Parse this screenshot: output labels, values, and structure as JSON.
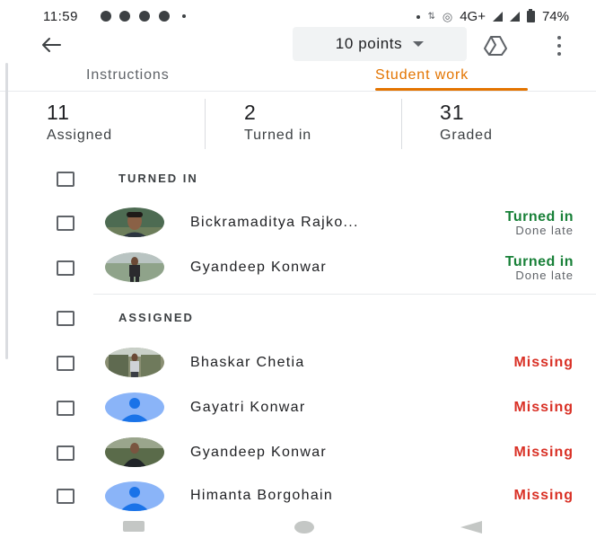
{
  "status_bar": {
    "time": "11:59",
    "network": "4G+",
    "battery": "74%"
  },
  "app_bar": {
    "points_label": "10 points"
  },
  "tabs": [
    {
      "label": "Instructions",
      "active": false
    },
    {
      "label": "Student work",
      "active": true
    }
  ],
  "stats": [
    {
      "count": "11",
      "label": "Assigned"
    },
    {
      "count": "2",
      "label": "Turned in"
    },
    {
      "count": "31",
      "label": "Graded"
    }
  ],
  "sections": {
    "turned_in": {
      "label": "TURNED IN",
      "students": [
        {
          "name": "Bickramaditya Rajko...",
          "status": "Turned in",
          "sub_status": "Done late"
        },
        {
          "name": "Gyandeep Konwar",
          "status": "Turned in",
          "sub_status": "Done late"
        }
      ]
    },
    "assigned": {
      "label": "ASSIGNED",
      "students": [
        {
          "name": "Bhaskar Chetia",
          "status": "Missing"
        },
        {
          "name": "Gayatri Konwar",
          "status": "Missing"
        },
        {
          "name": "Gyandeep Konwar",
          "status": "Missing"
        },
        {
          "name": "Himanta Borgohain",
          "status": "Missing"
        }
      ]
    }
  },
  "colors": {
    "accent": "#e37400",
    "turned_in": "#188038",
    "missing": "#d93025",
    "default_avatar": "#4285f4"
  },
  "icons": {
    "back": "arrow-left-icon",
    "dropdown": "caret-down-icon",
    "drive": "google-drive-icon",
    "menu": "more-vert-icon"
  }
}
